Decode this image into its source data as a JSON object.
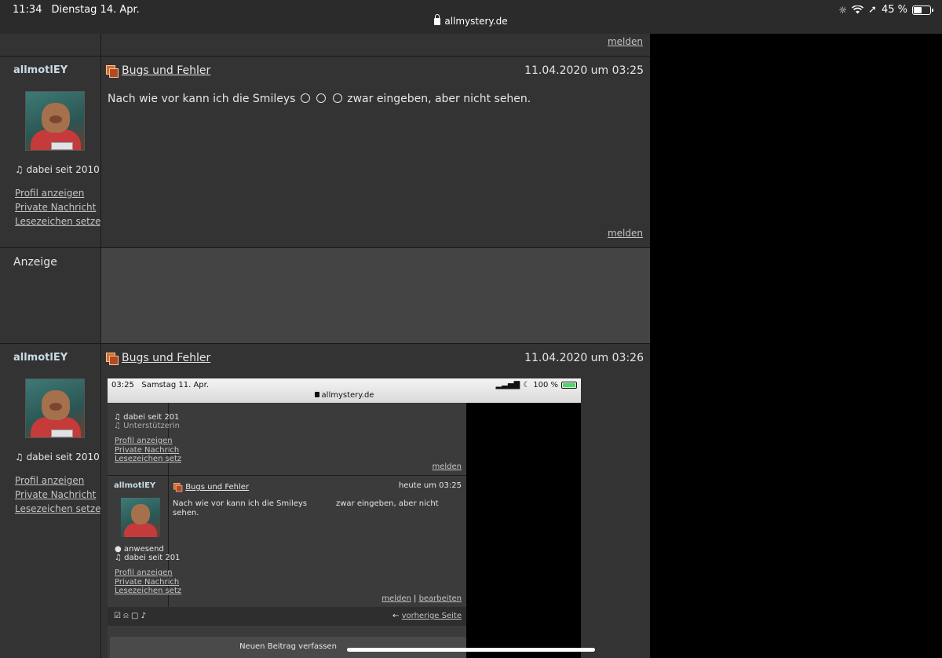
{
  "statusbar": {
    "time": "11:34",
    "date": "Dienstag 14. Apr.",
    "url": "allmystery.de",
    "battery": "45 %"
  },
  "top_report": "melden",
  "posts": [
    {
      "username": "allmotlEY",
      "member_since": "dabei seit 2010",
      "links": [
        "Profil anzeigen",
        "Private Nachricht",
        "Lesezeichen setzen"
      ],
      "topic": "Bugs und Fehler",
      "timestamp": "11.04.2020 um 03:25",
      "text_before": "Nach wie vor kann ich die Smileys",
      "text_after": "zwar eingeben, aber nicht sehen.",
      "report": "melden"
    },
    {
      "username": "allmotlEY",
      "member_since": "dabei seit 2010",
      "links": [
        "Profil anzeigen",
        "Private Nachricht",
        "Lesezeichen setzen"
      ],
      "topic": "Bugs und Fehler",
      "timestamp": "11.04.2020 um 03:26"
    }
  ],
  "ad": {
    "label": "Anzeige"
  },
  "embedded": {
    "time": "03:25",
    "date": "Samstag 11. Apr.",
    "url": "allmystery.de",
    "battery": "100 %",
    "prev_since": "dabei seit 201",
    "prev_role": "Unterstützerin",
    "prev_links": [
      "Profil anzeigen",
      "Private Nachrich",
      "Lesezeichen setz"
    ],
    "prev_report": "melden",
    "username": "allmotlEY",
    "topic": "Bugs und Fehler",
    "timestamp": "heute um 03:25",
    "text_line1_a": "Nach wie vor kann ich die Smileys",
    "text_line1_b": "zwar eingeben, aber nicht",
    "text_line2": "sehen.",
    "presence": "anwesend",
    "since": "dabei seit 201",
    "links": [
      "Profil anzeigen",
      "Private Nachrich",
      "Lesezeichen setz"
    ],
    "report": "melden",
    "separator": "|",
    "edit": "bearbeiten",
    "prev_page": "vorherige Seite",
    "new_post": "Neuen Beitrag verfassen"
  }
}
